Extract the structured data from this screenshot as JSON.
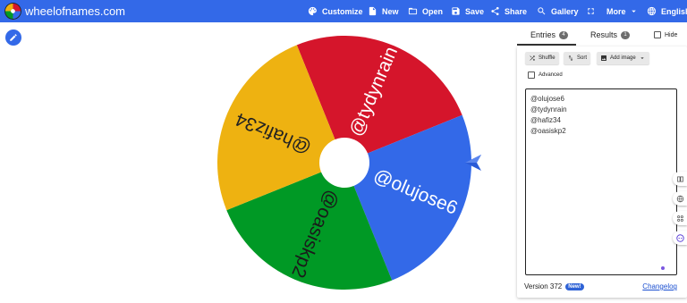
{
  "header": {
    "site_name": "wheelofnames.com",
    "nav": {
      "customize": "Customize",
      "new": "New",
      "open": "Open",
      "save": "Save",
      "share": "Share",
      "gallery": "Gallery",
      "more": "More",
      "language": "English"
    }
  },
  "wheel": {
    "segments": [
      {
        "label": "@tydynrain",
        "color": "#d5152b"
      },
      {
        "label": "@olujose6",
        "color": "#3369e8"
      },
      {
        "label": "@oasiskp2",
        "color": "#009925"
      },
      {
        "label": "@hafiz34",
        "color": "#eeb211"
      }
    ]
  },
  "panel": {
    "tabs": {
      "entries": "Entries",
      "entries_count": "4",
      "results": "Results",
      "results_count": "1"
    },
    "hide_label": "Hide",
    "toolbar": {
      "shuffle": "Shuffle",
      "sort": "Sort",
      "add_image": "Add image"
    },
    "advanced_label": "Advanced",
    "entries": [
      "@olujose6",
      "@tydynrain",
      "@hafiz34",
      "@oasiskp2"
    ],
    "version": "Version 372",
    "new_badge": "New!",
    "changelog": "Changelog"
  },
  "icons": [
    "palette-icon",
    "new-file-icon",
    "folder-open-icon",
    "save-icon",
    "share-icon",
    "search-icon",
    "fullscreen-icon",
    "chevron-down-icon",
    "globe-icon",
    "pencil-icon",
    "shuffle-icon",
    "sort-icon",
    "image-icon",
    "book-icon",
    "web-icon",
    "grid-icon",
    "face-icon"
  ],
  "colors": {
    "brand_blue": "#3369e8",
    "red": "#d5152b",
    "green": "#009925",
    "yellow": "#eeb211"
  }
}
